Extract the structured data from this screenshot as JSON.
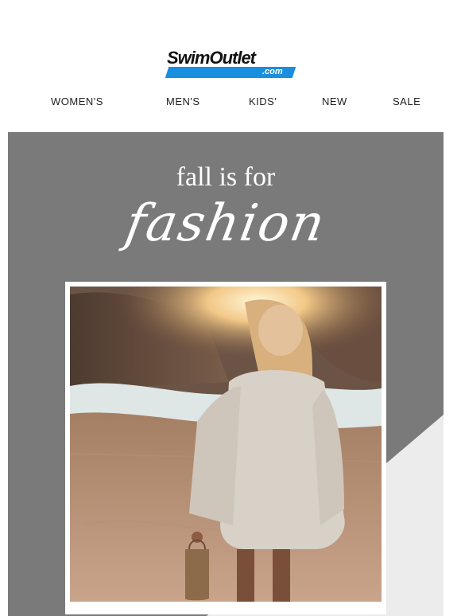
{
  "header": {
    "logo_main": "SwimOutlet",
    "logo_sub": ".com"
  },
  "nav": {
    "items": [
      {
        "label": "WOMEN'S"
      },
      {
        "label": "MEN'S"
      },
      {
        "label": "KIDS'"
      },
      {
        "label": "NEW"
      },
      {
        "label": "SALE"
      }
    ]
  },
  "hero": {
    "headline_small": "fall is for",
    "headline_script": "fashion"
  },
  "colors": {
    "brand_blue": "#1a8fe0",
    "hero_gray": "#7a7a7a",
    "light_panel": "#ececec"
  }
}
